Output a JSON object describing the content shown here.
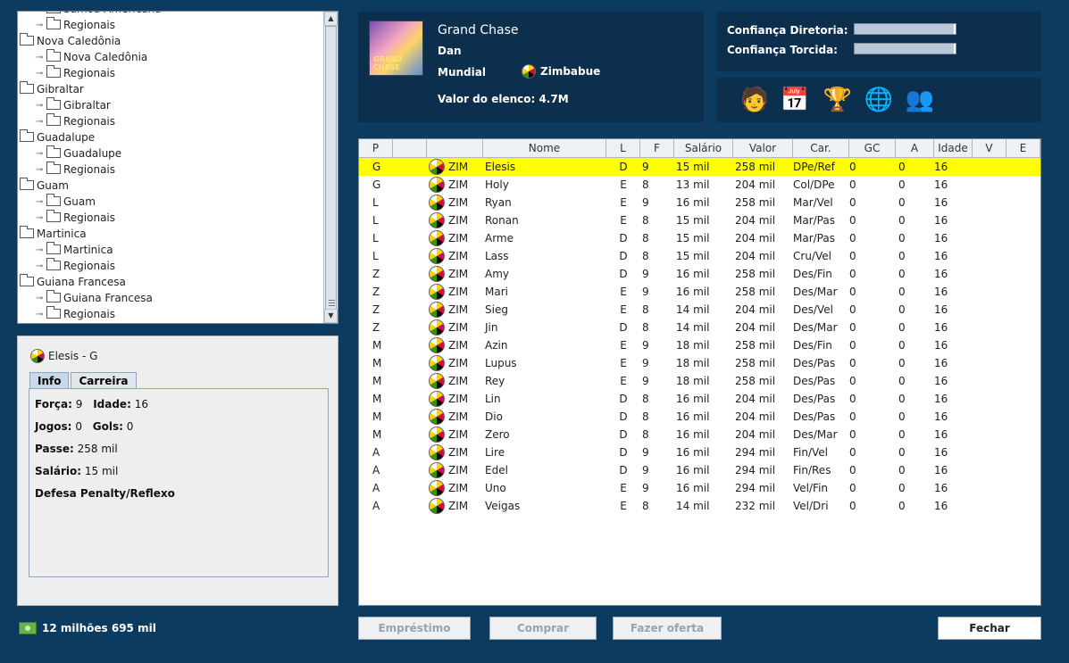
{
  "tree": {
    "items": [
      {
        "level": 1,
        "label": "Samoa Americana"
      },
      {
        "level": 1,
        "label": "Regionais"
      },
      {
        "level": 0,
        "label": "Nova Caledônia"
      },
      {
        "level": 1,
        "label": "Nova Caledônia"
      },
      {
        "level": 1,
        "label": "Regionais"
      },
      {
        "level": 0,
        "label": "Gibraltar"
      },
      {
        "level": 1,
        "label": "Gibraltar"
      },
      {
        "level": 1,
        "label": "Regionais"
      },
      {
        "level": 0,
        "label": "Guadalupe"
      },
      {
        "level": 1,
        "label": "Guadalupe"
      },
      {
        "level": 1,
        "label": "Regionais"
      },
      {
        "level": 0,
        "label": "Guam"
      },
      {
        "level": 1,
        "label": "Guam"
      },
      {
        "level": 1,
        "label": "Regionais"
      },
      {
        "level": 0,
        "label": "Martinica"
      },
      {
        "level": 1,
        "label": "Martinica"
      },
      {
        "level": 1,
        "label": "Regionais"
      },
      {
        "level": 0,
        "label": "Guiana Francesa"
      },
      {
        "level": 1,
        "label": "Guiana Francesa"
      },
      {
        "level": 1,
        "label": "Regionais"
      }
    ]
  },
  "player_panel": {
    "title": "Elesis - G",
    "tabs": [
      "Info",
      "Carreira"
    ],
    "forca_label": "Força:",
    "forca": "9",
    "idade_label": "Idade:",
    "idade": "16",
    "jogos_label": "Jogos:",
    "jogos": "0",
    "gols_label": "Gols:",
    "gols": "0",
    "passe_label": "Passe:",
    "passe": "258 mil",
    "salario_label": "Salário:",
    "salario": "15 mil",
    "caracteristica": "Defesa Penalty/Reflexo"
  },
  "money": "12 milhões 695 mil",
  "club": {
    "logo_text": "GRAND CHASE",
    "name": "Grand Chase",
    "coach": "Dan",
    "competition": "Mundial",
    "country": "Zimbabue",
    "value": "Valor do elenco: 4.7M"
  },
  "confidence": {
    "diretoria_label": "Confiança Diretoria:",
    "diretoria_level": 0.98,
    "torcida_label": "Confiança Torcida:",
    "torcida_level": 0.98
  },
  "actions": [
    {
      "name": "coach-icon",
      "glyph": "🧑"
    },
    {
      "name": "calendar-icon",
      "glyph": "📅"
    },
    {
      "name": "trophy-icon",
      "glyph": "🏆"
    },
    {
      "name": "stats-icon",
      "glyph": "🌐"
    },
    {
      "name": "hierarchy-icon",
      "glyph": "👥"
    }
  ],
  "table": {
    "headers": [
      "P",
      "",
      "",
      "Nome",
      "L",
      "F",
      "Salário",
      "Valor",
      "Car.",
      "GC",
      "A",
      "Idade",
      "V",
      "E"
    ],
    "rows": [
      [
        "G",
        "ZIM",
        "Elesis",
        "D",
        "9",
        "15 mil",
        "258 mil",
        "DPe/Ref",
        "0",
        "0",
        "16"
      ],
      [
        "G",
        "ZIM",
        "Holy",
        "E",
        "8",
        "13 mil",
        "204 mil",
        "Col/DPe",
        "0",
        "0",
        "16"
      ],
      [
        "L",
        "ZIM",
        "Ryan",
        "E",
        "9",
        "16 mil",
        "258 mil",
        "Mar/Vel",
        "0",
        "0",
        "16"
      ],
      [
        "L",
        "ZIM",
        "Ronan",
        "E",
        "8",
        "15 mil",
        "204 mil",
        "Mar/Pas",
        "0",
        "0",
        "16"
      ],
      [
        "L",
        "ZIM",
        "Arme",
        "D",
        "8",
        "15 mil",
        "204 mil",
        "Mar/Pas",
        "0",
        "0",
        "16"
      ],
      [
        "L",
        "ZIM",
        "Lass",
        "D",
        "8",
        "15 mil",
        "204 mil",
        "Cru/Vel",
        "0",
        "0",
        "16"
      ],
      [
        "Z",
        "ZIM",
        "Amy",
        "D",
        "9",
        "16 mil",
        "258 mil",
        "Des/Fin",
        "0",
        "0",
        "16"
      ],
      [
        "Z",
        "ZIM",
        "Mari",
        "E",
        "9",
        "16 mil",
        "258 mil",
        "Des/Mar",
        "0",
        "0",
        "16"
      ],
      [
        "Z",
        "ZIM",
        "Sieg",
        "E",
        "8",
        "14 mil",
        "204 mil",
        "Des/Vel",
        "0",
        "0",
        "16"
      ],
      [
        "Z",
        "ZIM",
        "Jin",
        "D",
        "8",
        "14 mil",
        "204 mil",
        "Des/Mar",
        "0",
        "0",
        "16"
      ],
      [
        "M",
        "ZIM",
        "Azin",
        "E",
        "9",
        "18 mil",
        "258 mil",
        "Des/Fin",
        "0",
        "0",
        "16"
      ],
      [
        "M",
        "ZIM",
        "Lupus",
        "E",
        "9",
        "18 mil",
        "258 mil",
        "Des/Pas",
        "0",
        "0",
        "16"
      ],
      [
        "M",
        "ZIM",
        "Rey",
        "E",
        "9",
        "18 mil",
        "258 mil",
        "Des/Pas",
        "0",
        "0",
        "16"
      ],
      [
        "M",
        "ZIM",
        "Lin",
        "D",
        "8",
        "16 mil",
        "204 mil",
        "Des/Pas",
        "0",
        "0",
        "16"
      ],
      [
        "M",
        "ZIM",
        "Dio",
        "D",
        "8",
        "16 mil",
        "204 mil",
        "Des/Pas",
        "0",
        "0",
        "16"
      ],
      [
        "M",
        "ZIM",
        "Zero",
        "D",
        "8",
        "16 mil",
        "204 mil",
        "Des/Mar",
        "0",
        "0",
        "16"
      ],
      [
        "A",
        "ZIM",
        "Lire",
        "D",
        "9",
        "16 mil",
        "294 mil",
        "Fin/Vel",
        "0",
        "0",
        "16"
      ],
      [
        "A",
        "ZIM",
        "Edel",
        "D",
        "9",
        "16 mil",
        "294 mil",
        "Fin/Res",
        "0",
        "0",
        "16"
      ],
      [
        "A",
        "ZIM",
        "Uno",
        "E",
        "9",
        "16 mil",
        "294 mil",
        "Vel/Fin",
        "0",
        "0",
        "16"
      ],
      [
        "A",
        "ZIM",
        "Veigas",
        "E",
        "8",
        "14 mil",
        "232 mil",
        "Vel/Dri",
        "0",
        "0",
        "16"
      ]
    ]
  },
  "buttons": {
    "emprestimo": "Empréstimo",
    "comprar": "Comprar",
    "fazer_oferta": "Fazer oferta",
    "fechar": "Fechar"
  }
}
